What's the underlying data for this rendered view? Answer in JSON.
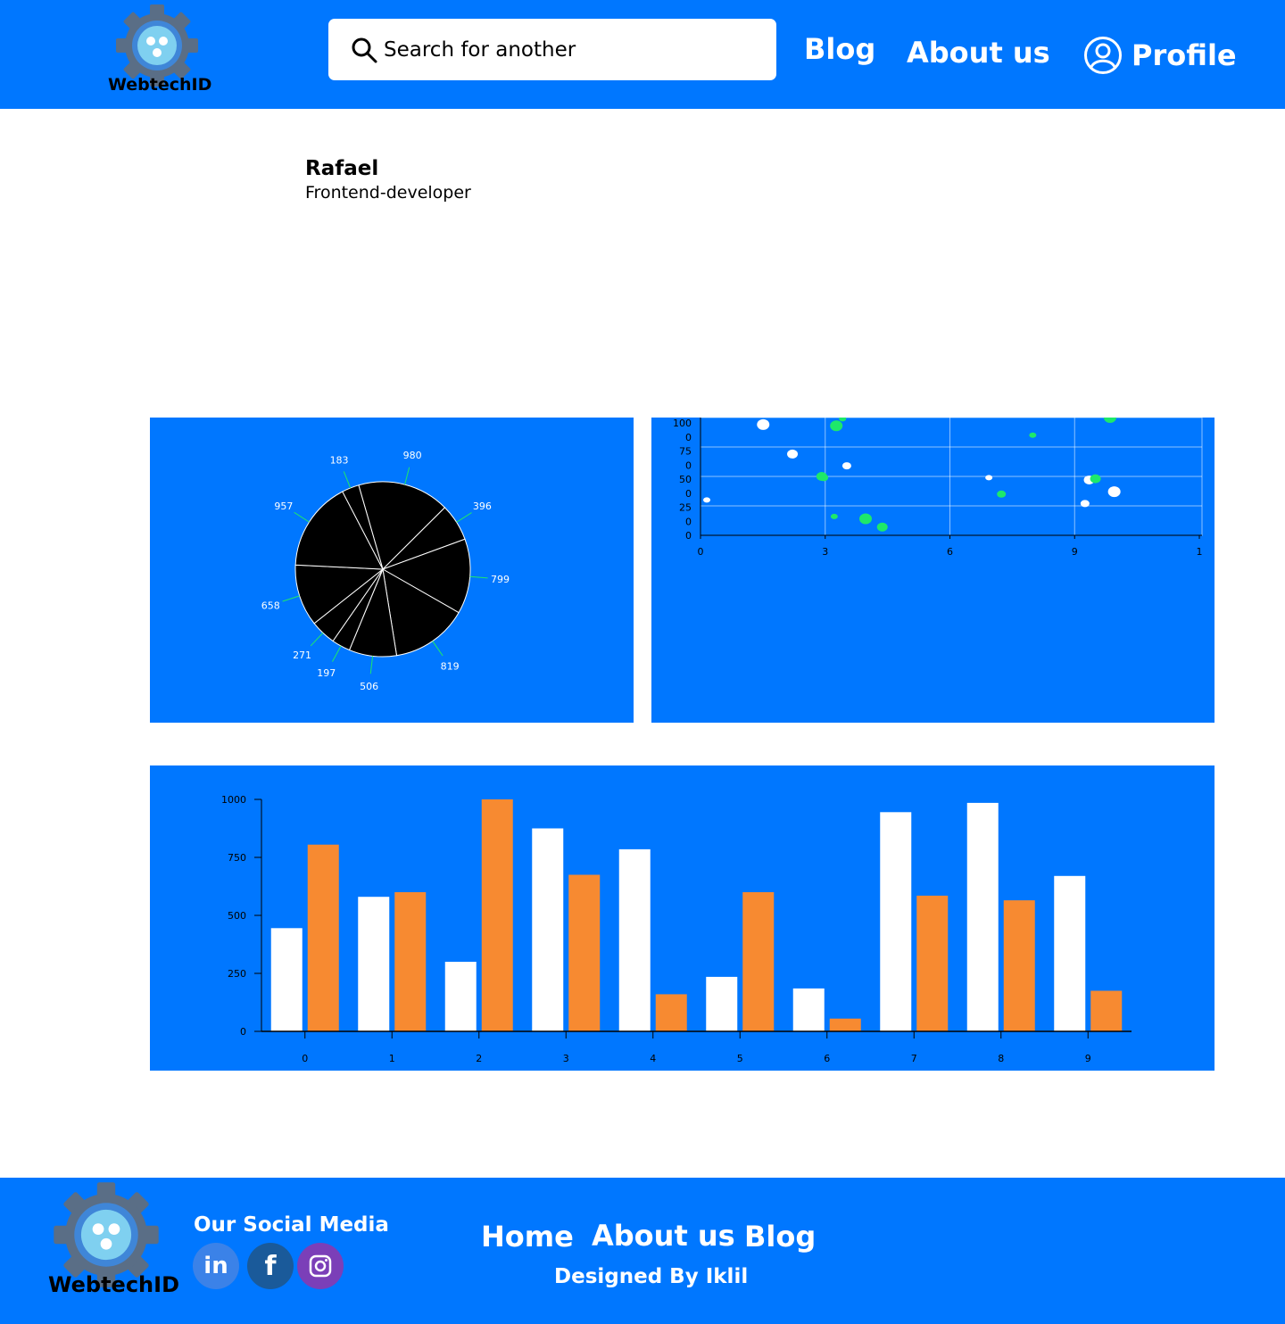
{
  "header": {
    "logo_text": "WebtechID",
    "search_placeholder": "Search for another",
    "nav": {
      "blog": "Blog",
      "about": "About us",
      "profile": "Profile"
    }
  },
  "user": {
    "name": "Rafael",
    "role": "Frontend-developer"
  },
  "colors": {
    "primary": "#0077ff",
    "white": "#ffffff",
    "orange": "#f78a31",
    "green": "#1ee86a",
    "pie_fill": "#000000"
  },
  "chart_data": [
    {
      "type": "pie",
      "values": [
        980,
        396,
        799,
        819,
        506,
        197,
        271,
        658,
        957,
        183
      ],
      "labels": [
        "980",
        "396",
        "799",
        "819",
        "506",
        "197",
        "271",
        "658",
        "957",
        "183"
      ]
    },
    {
      "type": "scatter",
      "x_ticks": [
        "0",
        "3",
        "6",
        "9",
        "1"
      ],
      "y_ticks": [
        "100",
        "0",
        "75",
        "0",
        "50",
        "0",
        "25",
        "0",
        "0"
      ],
      "xlim": [
        0,
        12
      ],
      "ylim": [
        0,
        100
      ],
      "grid": true,
      "series": [
        {
          "color": "#ffffff",
          "points": [
            [
              0.15,
              30
            ],
            [
              1.5,
              94
            ],
            [
              2.2,
              69
            ],
            [
              3.5,
              59
            ],
            [
              6.9,
              49
            ],
            [
              9.9,
              37
            ],
            [
              9.3,
              47
            ],
            [
              9.2,
              27
            ]
          ]
        },
        {
          "color": "#1ee86a",
          "points": [
            [
              3.4,
              99
            ],
            [
              3.25,
              93
            ],
            [
              2.9,
              50
            ],
            [
              2.95,
              49
            ],
            [
              3.2,
              16
            ],
            [
              3.95,
              14
            ],
            [
              4.35,
              7
            ],
            [
              7.2,
              35
            ],
            [
              7.95,
              85
            ],
            [
              9.8,
              100
            ],
            [
              9.45,
              48
            ]
          ]
        }
      ]
    },
    {
      "type": "bar",
      "categories": [
        "0",
        "1",
        "2",
        "3",
        "4",
        "5",
        "6",
        "7",
        "8",
        "9"
      ],
      "ylim": [
        0,
        1000
      ],
      "y_ticks": [
        "1000",
        "750",
        "500",
        "250",
        "0"
      ],
      "series": [
        {
          "color": "#ffffff",
          "values": [
            445,
            580,
            300,
            875,
            785,
            235,
            185,
            945,
            985,
            670
          ]
        },
        {
          "color": "#f78a31",
          "values": [
            805,
            600,
            1000,
            675,
            160,
            600,
            55,
            585,
            565,
            175
          ]
        }
      ]
    }
  ],
  "footer": {
    "logo_text": "WebtechID",
    "social_title": "Our Social Media",
    "social_icons": [
      "linkedin-icon",
      "facebook-icon",
      "instagram-icon"
    ],
    "links": {
      "home": "Home",
      "about": "About us",
      "blog": "Blog"
    },
    "designed_by": "Designed By Iklil"
  }
}
